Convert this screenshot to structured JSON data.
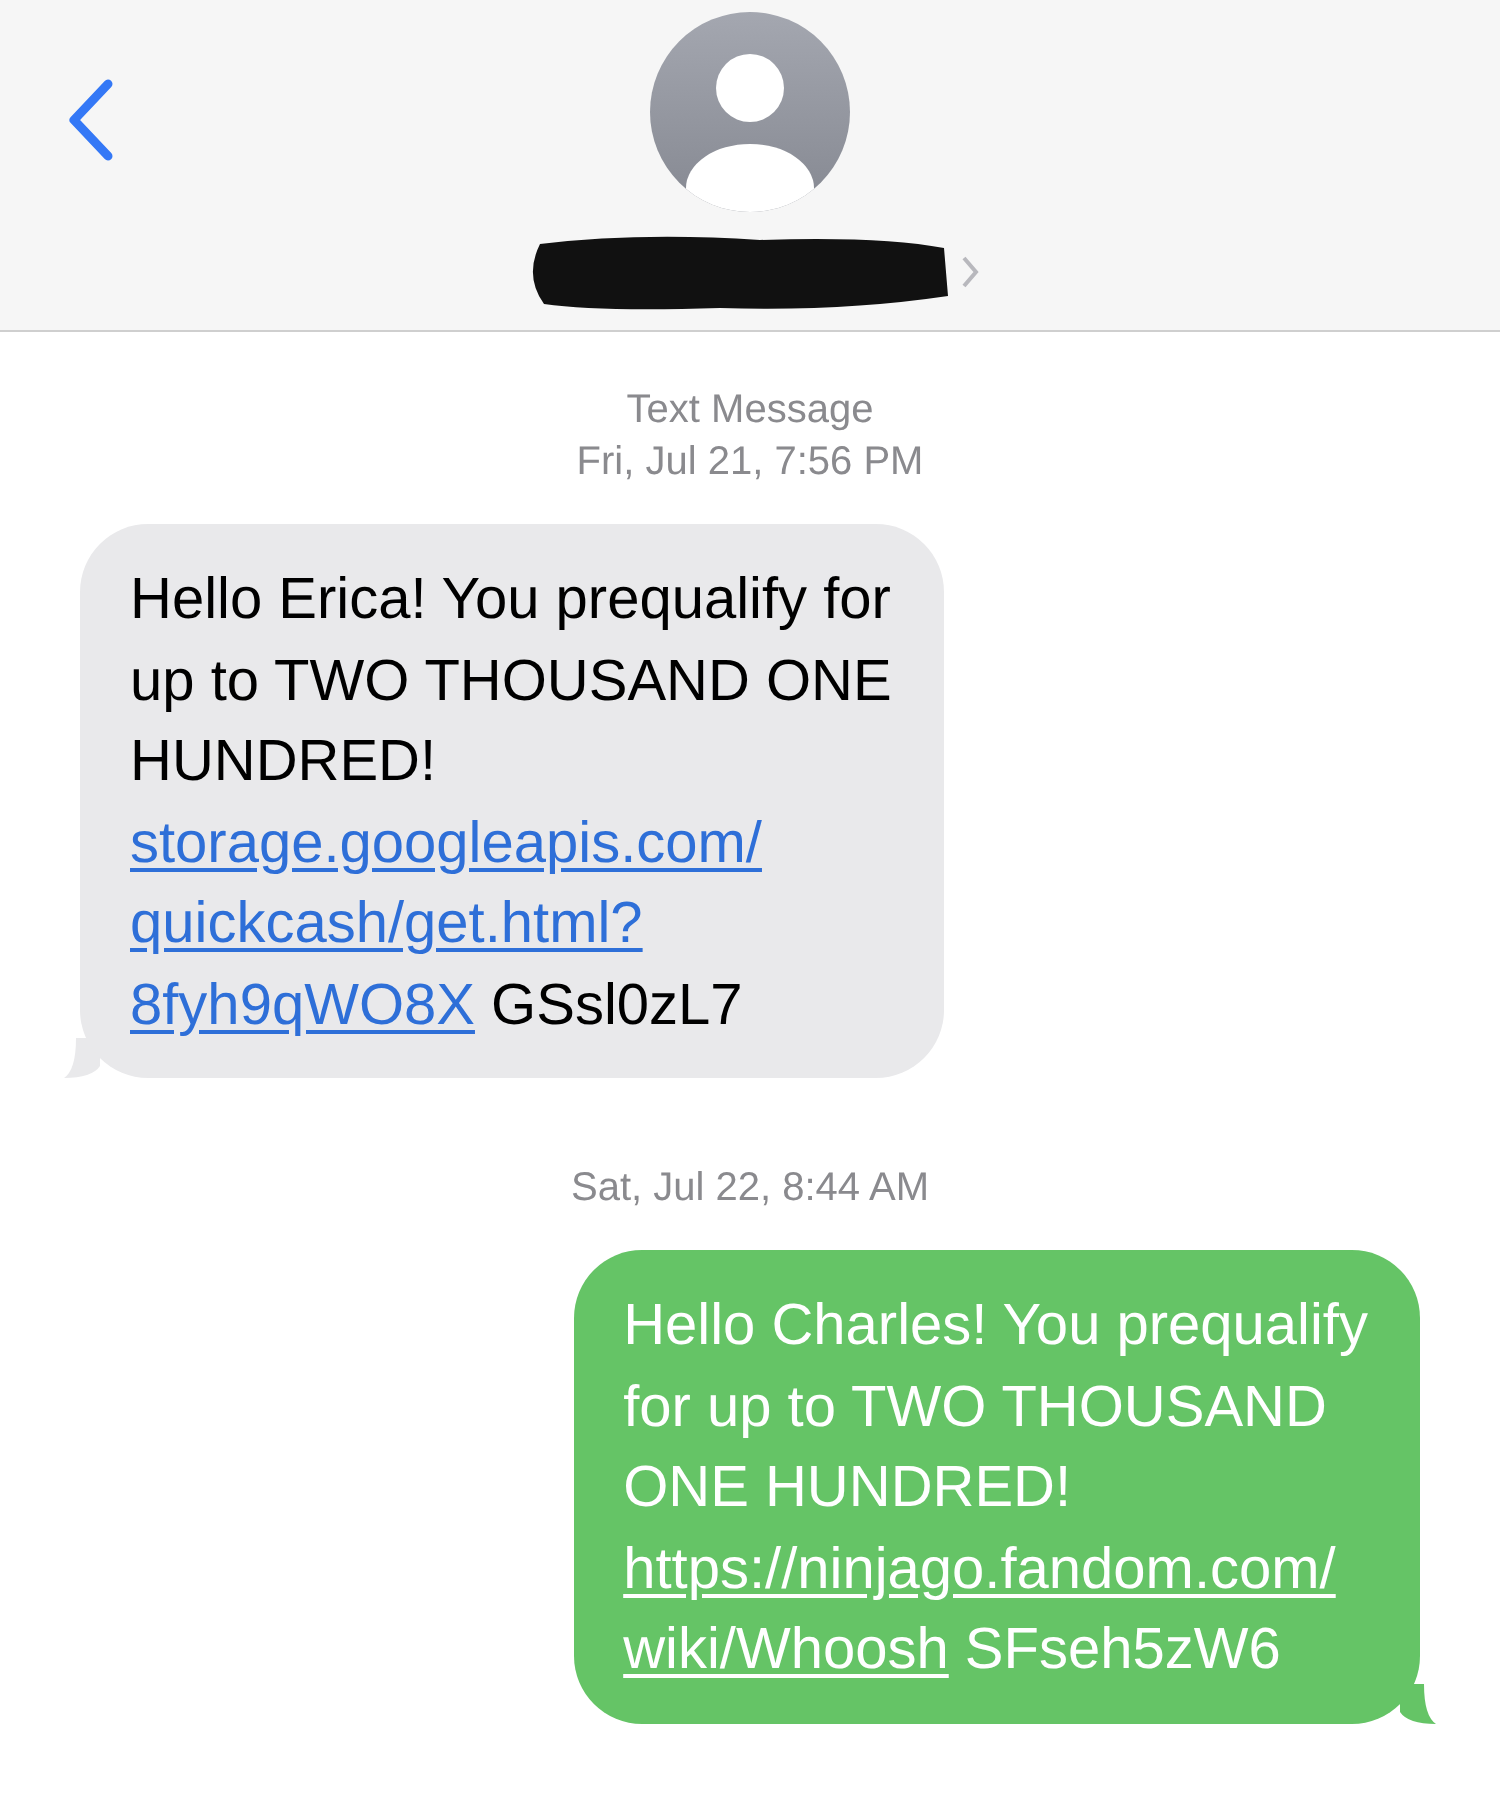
{
  "thread": [
    {
      "kind": "stamp",
      "label": "Text Message",
      "time": "Fri, Jul 21, 7:56 PM"
    },
    {
      "kind": "message",
      "outgoing": false,
      "lines": [
        [
          {
            "text": "Hello Erica! You prequalify for"
          }
        ],
        [
          {
            "text": "up to TWO THOUSAND ONE"
          }
        ],
        [
          {
            "text": "HUNDRED!"
          }
        ],
        [
          {
            "text": "storage.googleapis.com/",
            "link": true
          }
        ],
        [
          {
            "text": "quickcash/get.html?",
            "link": true
          }
        ],
        [
          {
            "text": "8fyh9qWO8X",
            "link": true
          },
          {
            "text": " GSsl0zL7"
          }
        ]
      ]
    },
    {
      "kind": "stamp",
      "time": "Sat, Jul 22, 8:44 AM"
    },
    {
      "kind": "message",
      "outgoing": true,
      "lines": [
        [
          {
            "text": "Hello Charles! You prequalify"
          }
        ],
        [
          {
            "text": "for up to TWO THOUSAND"
          }
        ],
        [
          {
            "text": "ONE HUNDRED!"
          }
        ],
        [
          {
            "text": "https://ninjago.fandom.com/",
            "link": true
          }
        ],
        [
          {
            "text": "wiki/Whoosh",
            "link": true
          },
          {
            "text": " SFseh5zW6"
          }
        ]
      ]
    }
  ]
}
